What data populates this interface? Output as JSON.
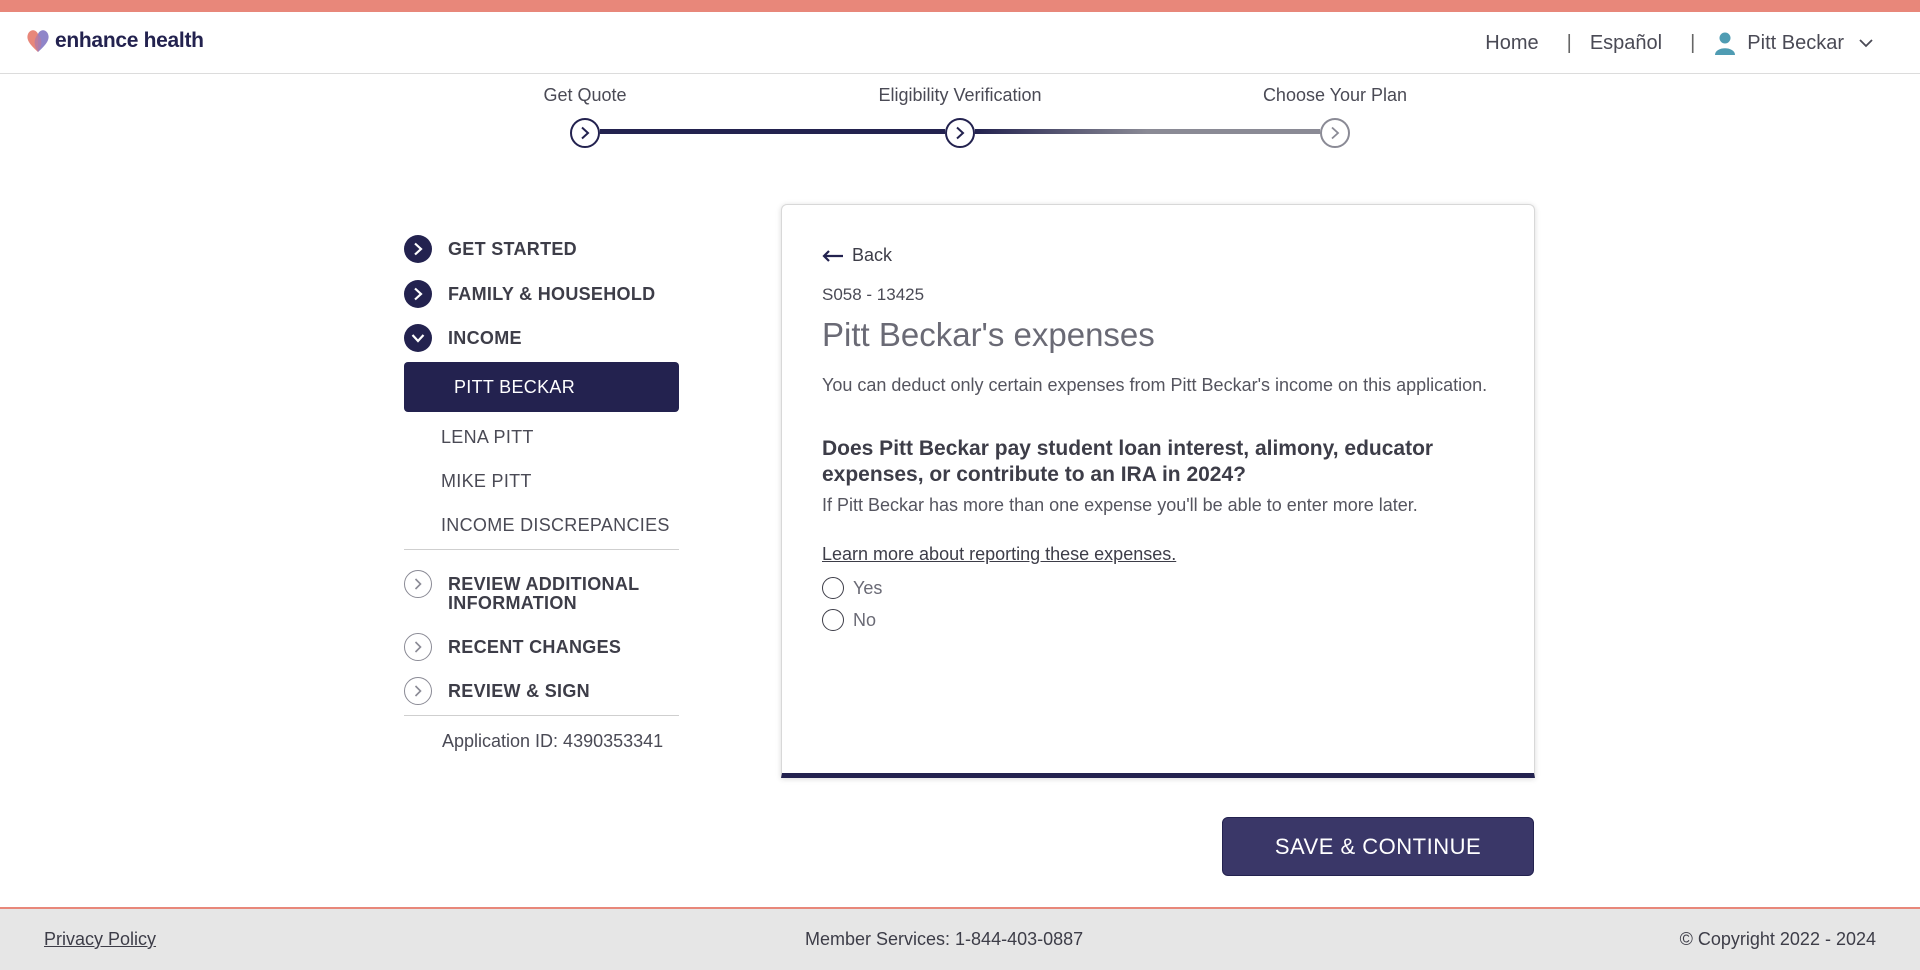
{
  "brand": {
    "name": "enhance health",
    "accent": "#e8877a",
    "primary": "#23224f"
  },
  "header": {
    "nav_home": "Home",
    "nav_sep1": "|",
    "nav_language": "Español",
    "nav_sep2": "|",
    "user_name": "Pitt Beckar",
    "user_icon": "person-icon",
    "menu_icon": "chevron-down-icon"
  },
  "stepper": {
    "steps": [
      {
        "label": "Get Quote",
        "state": "complete"
      },
      {
        "label": "Eligibility Verification",
        "state": "current"
      },
      {
        "label": "Choose Your Plan",
        "state": "upcoming"
      }
    ]
  },
  "sidebar": {
    "sections": [
      {
        "label": "GET STARTED",
        "icon": "chevron-right-icon",
        "state": "done"
      },
      {
        "label": "FAMILY & HOUSEHOLD",
        "icon": "chevron-right-icon",
        "state": "done"
      },
      {
        "label": "INCOME",
        "icon": "chevron-down-icon",
        "state": "expanded"
      },
      {
        "label": "REVIEW ADDITIONAL INFORMATION",
        "icon": "chevron-right-icon",
        "state": "pending"
      },
      {
        "label": "RECENT CHANGES",
        "icon": "chevron-right-icon",
        "state": "pending"
      },
      {
        "label": "REVIEW & SIGN",
        "icon": "chevron-right-icon",
        "state": "pending"
      }
    ],
    "income_items": [
      "PITT BECKAR",
      "LENA PITT",
      "MIKE PITT",
      "INCOME DISCREPANCIES"
    ],
    "application_id": "Application ID: 4390353341"
  },
  "card": {
    "back_label": "Back",
    "screen_code": "S058 - 13425",
    "title": "Pitt Beckar's expenses",
    "intro": "You can deduct only certain expenses from Pitt Beckar's income on this application.",
    "question": "Does Pitt Beckar pay student loan interest, alimony, educator expenses, or contribute to an IRA in 2024?",
    "hint": "If Pitt Beckar has more than one expense you'll be able to enter more later.",
    "learn_more": "Learn more about reporting these expenses.",
    "options": [
      "Yes",
      "No"
    ],
    "selected": null
  },
  "actions": {
    "save_continue": "SAVE & CONTINUE"
  },
  "footer": {
    "privacy": "Privacy Policy",
    "member_services": "Member Services: 1-844-403-0887",
    "copyright": "© Copyright 2022 - 2024"
  }
}
